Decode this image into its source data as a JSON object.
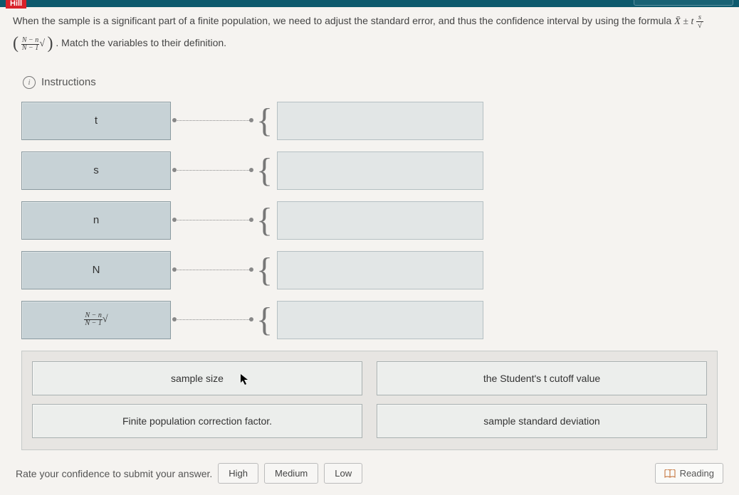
{
  "topbar": {
    "logo": "Hill"
  },
  "question": {
    "line1_a": "When the sample is a significant part of a finite population, we need to adjust the standard error, and thus the confidence interval by using the formula ",
    "line2": ". Match the variables to their definition."
  },
  "instructions_label": "Instructions",
  "match_items": [
    {
      "label": "t"
    },
    {
      "label": "s"
    },
    {
      "label": "n"
    },
    {
      "label": "N"
    },
    {
      "label": "__fpc__"
    }
  ],
  "answers": {
    "row1": [
      "sample size",
      "the Student's t cutoff value"
    ],
    "row2": [
      "Finite population correction factor.",
      "sample standard deviation"
    ]
  },
  "footer": {
    "prompt": "Rate your confidence to submit your answer.",
    "high": "High",
    "medium": "Medium",
    "low": "Low",
    "reading": "Reading"
  }
}
